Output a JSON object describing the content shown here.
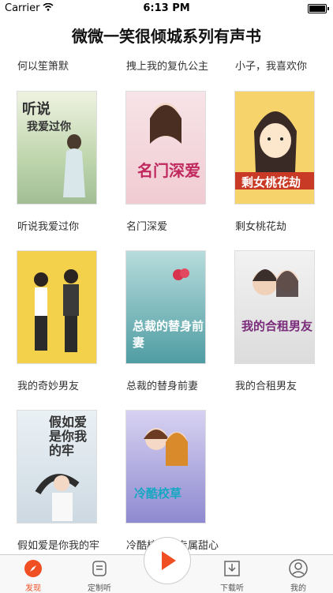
{
  "status": {
    "carrier": "Carrier",
    "time": "6:13 PM"
  },
  "header": {
    "title": "微微一笑很倾城系列有声书"
  },
  "top_titles": [
    "何以笙箫默",
    "拽上我的复仇公主",
    "小子，我喜欢你"
  ],
  "books": [
    {
      "title": "听说我爱过你",
      "cover_text": "听说\n我爱过你",
      "cover_color": "#c9d7b2"
    },
    {
      "title": "名门深爱",
      "cover_text": "名门深爱",
      "cover_color": "#f2d7dc"
    },
    {
      "title": "剩女桃花劫",
      "cover_text": "剩女桃花劫",
      "cover_color": "#f1c55a"
    },
    {
      "title": "我的奇妙男友",
      "cover_text": "",
      "cover_color": "#f3d14a"
    },
    {
      "title": "总裁的替身前妻",
      "cover_text": "总裁的替身前妻",
      "cover_color": "#6ab7b8"
    },
    {
      "title": "我的合租男友",
      "cover_text": "我的合租男友",
      "cover_color": "#e7e7e7"
    },
    {
      "title": "假如爱是你我的牢",
      "cover_text": "假如爱是你我的牢",
      "cover_color": "#dfe8ef"
    },
    {
      "title": "冷酷校草的专属甜心",
      "cover_text": "",
      "cover_color": "#a7a5d6"
    }
  ],
  "tabs": [
    "发现",
    "定制听",
    "下载听",
    "我的"
  ],
  "colors": {
    "accent": "#f04e23"
  }
}
